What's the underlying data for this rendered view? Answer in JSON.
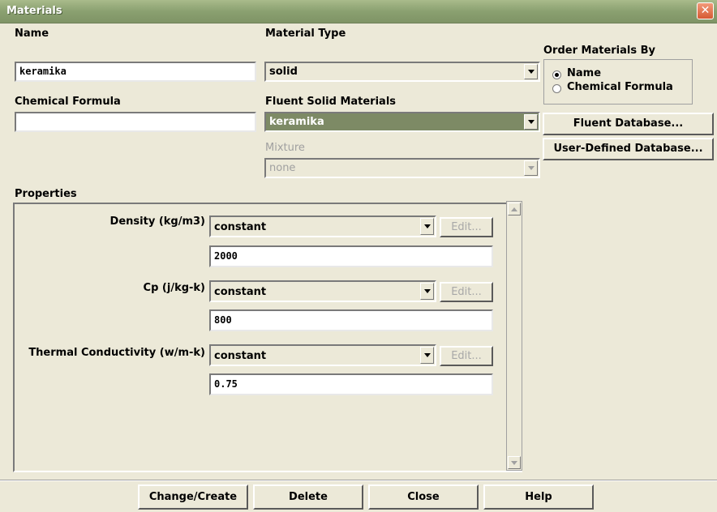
{
  "window": {
    "title": "Materials"
  },
  "name": {
    "label": "Name",
    "value": "keramika"
  },
  "chemical_formula": {
    "label": "Chemical Formula",
    "value": ""
  },
  "material_type": {
    "label": "Material Type",
    "value": "solid"
  },
  "fluent_solid_materials": {
    "label": "Fluent Solid Materials",
    "value": "keramika"
  },
  "mixture": {
    "label": "Mixture",
    "value": "none"
  },
  "order_by": {
    "label": "Order Materials By",
    "options": [
      {
        "label": "Name",
        "checked": true
      },
      {
        "label": "Chemical Formula",
        "checked": false
      }
    ]
  },
  "database_buttons": {
    "fluent": "Fluent Database...",
    "user_defined": "User-Defined Database..."
  },
  "properties": {
    "label": "Properties",
    "items": [
      {
        "label": "Density (kg/m3)",
        "method": "constant",
        "edit": "Edit...",
        "value": "2000"
      },
      {
        "label": "Cp (j/kg-k)",
        "method": "constant",
        "edit": "Edit...",
        "value": "800"
      },
      {
        "label": "Thermal Conductivity (w/m-k)",
        "method": "constant",
        "edit": "Edit...",
        "value": "0.75"
      }
    ]
  },
  "footer": {
    "change_create": "Change/Create",
    "delete": "Delete",
    "close": "Close",
    "help": "Help"
  },
  "colors": {
    "title_bar": "#8aa070",
    "selected_highlight": "#7d8a65",
    "close_button": "#d65a33"
  }
}
